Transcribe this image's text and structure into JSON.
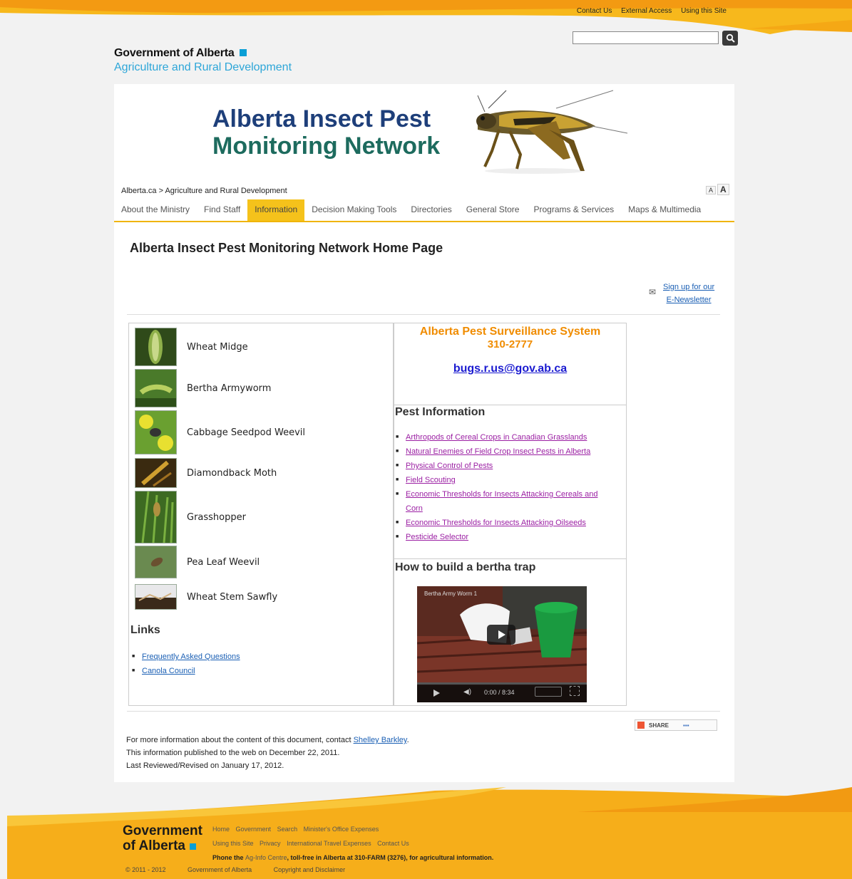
{
  "utility_links": [
    "Contact Us",
    "External Access",
    "Using this Site"
  ],
  "search": {
    "placeholder": ""
  },
  "header": {
    "gov_name": "Government of Alberta",
    "ministry": "Agriculture and Rural Development"
  },
  "banner": {
    "line1": "Alberta Insect Pest",
    "line2": "Monitoring Network"
  },
  "breadcrumb": "Alberta.ca > Agriculture and Rural Development",
  "font_size": {
    "small": "A",
    "large": "A"
  },
  "nav": [
    {
      "label": "About the Ministry"
    },
    {
      "label": "Find Staff"
    },
    {
      "label": "Information",
      "active": true
    },
    {
      "label": "Decision Making Tools"
    },
    {
      "label": "Directories"
    },
    {
      "label": "General Store"
    },
    {
      "label": "Programs & Services"
    },
    {
      "label": "Maps & Multimedia"
    }
  ],
  "page_title": "Alberta Insect Pest Monitoring Network Home Page",
  "newsletter": {
    "line1": "Sign up for our",
    "line2": "E-Newsletter"
  },
  "pests": [
    {
      "name": "Wheat Midge"
    },
    {
      "name": "Bertha Armyworm"
    },
    {
      "name": "Cabbage Seedpod Weevil"
    },
    {
      "name": "Diamondback Moth"
    },
    {
      "name": "Grasshopper"
    },
    {
      "name": "Pea Leaf Weevil"
    },
    {
      "name": "Wheat Stem Sawfly"
    }
  ],
  "links_section": {
    "title": "Links",
    "items": [
      "Frequently Asked Questions",
      "Canola Council"
    ]
  },
  "surveillance": {
    "title": "Alberta Pest Surveillance System",
    "phone": "310-2777",
    "email": "bugs.r.us@gov.ab.ca"
  },
  "pest_info": {
    "title": "Pest Information",
    "items": [
      "Arthropods of Cereal Crops in Canadian Grasslands",
      "Natural Enemies of Field Crop Insect Pests in Alberta",
      "Physical Control of Pests",
      "Field Scouting",
      "Economic Thresholds for Insects Attacking Cereals and Corn",
      "Economic Thresholds for Insects Attacking Oilseeds",
      "Pesticide Selector"
    ]
  },
  "bertha": {
    "title": "How to build a bertha trap",
    "video_title": "Bertha Army Worm 1",
    "time": "0:00 / 8:34"
  },
  "doc_info": {
    "contact_prefix": "For more information about the content of this document, contact ",
    "contact_name": "Shelley Barkley",
    "contact_suffix": ".",
    "published": "This information published to the web on December 22, 2011.",
    "reviewed": "Last Reviewed/Revised on January 17, 2012."
  },
  "share": {
    "label": "SHARE"
  },
  "footer": {
    "gov_line1": "Government",
    "gov_line2": "of Alberta",
    "links_row1": [
      "Home",
      "Government",
      "Search",
      "Minister's Office Expenses"
    ],
    "links_row2": [
      "Using this Site",
      "Privacy",
      "International Travel Expenses",
      "Contact Us"
    ],
    "phone_prefix": "Phone the ",
    "phone_link": "Ag-Info Centre",
    "phone_suffix": ", toll-free in Alberta at 310-FARM (3276), for agricultural information.",
    "copyright": "© 2011 - 2012",
    "gov_link": "Government of Alberta",
    "disclaimer": "Copyright and Disclaimer"
  },
  "colors": {
    "accent": "#f5c21b",
    "banner_blue": "#1e3f7a",
    "banner_green": "#1d6b5e",
    "orange": "#f08c00",
    "link_purple": "#9b1fa3"
  }
}
